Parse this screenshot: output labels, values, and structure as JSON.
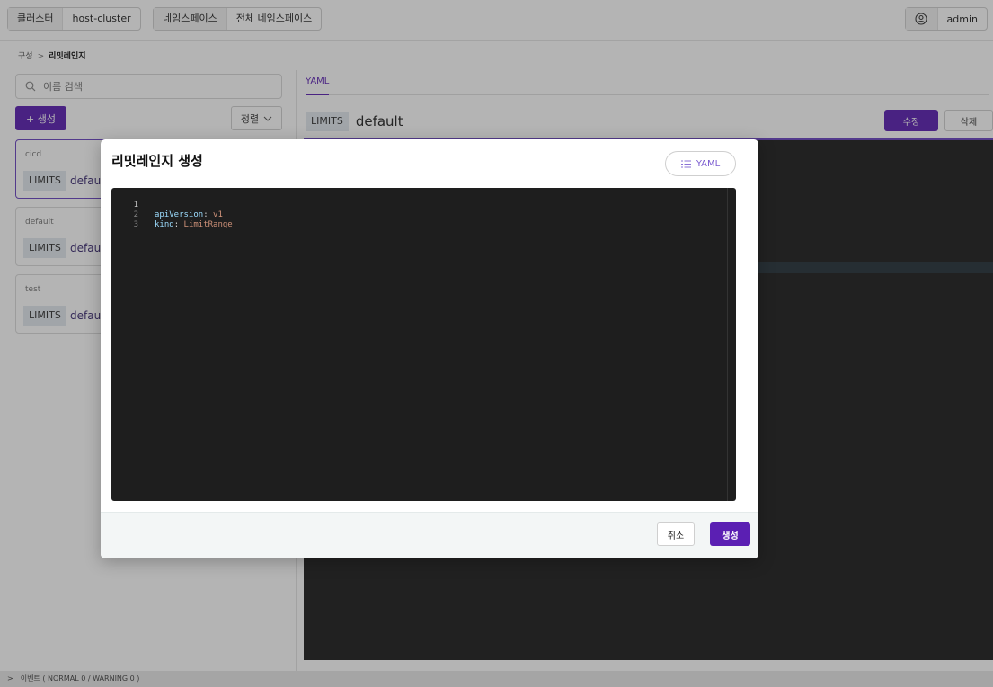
{
  "topbar": {
    "cluster_label": "클러스터",
    "cluster_value": "host-cluster",
    "namespace_label": "네임스페이스",
    "namespace_value": "전체 네임스페이스",
    "user_icon": "user-circle-icon",
    "user_name": "admin"
  },
  "breadcrumb": {
    "parent": "구성",
    "separator": ">",
    "current": "리밋레인지"
  },
  "sidebar": {
    "search_placeholder": "이름 검색",
    "create_label": "+ 생성",
    "sort_label": "정렬",
    "items": [
      {
        "name": "cicd",
        "tag": "LIMITS",
        "value": "default"
      },
      {
        "name": "default",
        "tag": "LIMITS",
        "value": "default"
      },
      {
        "name": "test",
        "tag": "LIMITS",
        "value": "default"
      }
    ]
  },
  "detail": {
    "tab_label": "YAML",
    "tag": "LIMITS",
    "name": "default",
    "edit_label": "수정",
    "delete_label": "삭제"
  },
  "modal": {
    "title": "리밋레인지 생성",
    "yaml_toggle_label": "YAML",
    "lines": [
      {
        "num": "1",
        "key": "apiVersion",
        "value": "v1"
      },
      {
        "num": "2",
        "key": "kind",
        "value": "LimitRange"
      },
      {
        "num": "3",
        "key": "",
        "value": ""
      }
    ],
    "cancel_label": "취소",
    "submit_label": "생성"
  },
  "footer": {
    "events_label": "이벤트 ( NORMAL 0 / WARNING 0 )"
  },
  "colors": {
    "accent": "#5b1fb3",
    "editor_bg": "#1e1e1e",
    "yaml_key": "#9cdcfe",
    "yaml_value": "#ce9178"
  }
}
